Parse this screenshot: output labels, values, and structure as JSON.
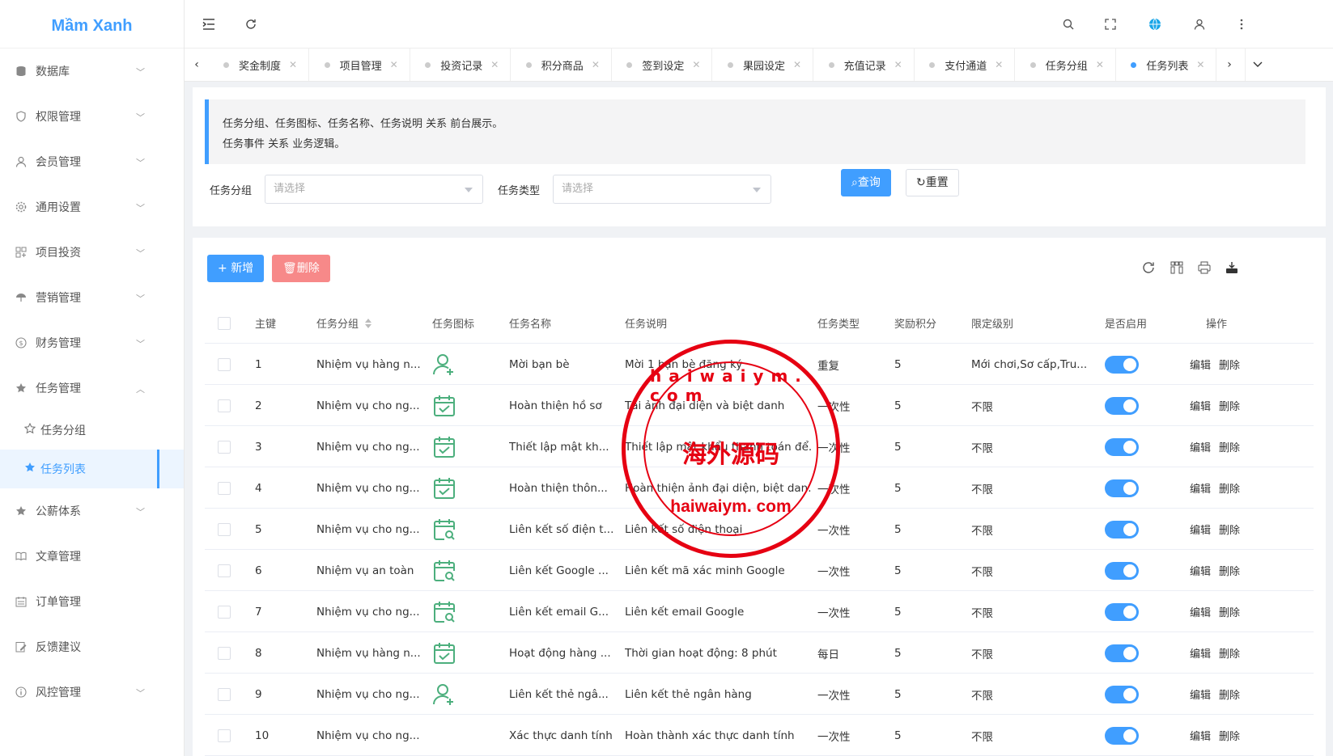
{
  "app": {
    "logo": "Mầm Xanh"
  },
  "sidebar": {
    "items": [
      {
        "label": "数据库",
        "icon": "database-icon"
      },
      {
        "label": "权限管理",
        "icon": "shield-icon"
      },
      {
        "label": "会员管理",
        "icon": "user-icon"
      },
      {
        "label": "通用设置",
        "icon": "gear-icon"
      },
      {
        "label": "项目投资",
        "icon": "grid-icon"
      },
      {
        "label": "营销管理",
        "icon": "umbrella-icon"
      },
      {
        "label": "财务管理",
        "icon": "dollar-icon"
      },
      {
        "label": "任务管理",
        "icon": "star-icon"
      }
    ],
    "sub_items": [
      {
        "label": "任务分组",
        "icon": "star-outline-icon"
      },
      {
        "label": "任务列表",
        "icon": "star-icon"
      }
    ],
    "items_after": [
      {
        "label": "公薪体系",
        "icon": "star-icon"
      },
      {
        "label": "文章管理",
        "icon": "book-icon"
      },
      {
        "label": "订单管理",
        "icon": "calendar-icon"
      },
      {
        "label": "反馈建议",
        "icon": "edit-icon"
      },
      {
        "label": "风控管理",
        "icon": "info-icon"
      }
    ]
  },
  "tabs": [
    "奖金制度",
    "项目管理",
    "投资记录",
    "积分商品",
    "签到设定",
    "果园设定",
    "充值记录",
    "支付通道",
    "任务分组",
    "任务列表"
  ],
  "notice": {
    "line1": "任务分组、任务图标、任务名称、任务说明 关系 前台展示。",
    "line2": "任务事件 关系 业务逻辑。"
  },
  "filters": {
    "group_label": "任务分组",
    "group_placeholder": "请选择",
    "type_label": "任务类型",
    "type_placeholder": "请选择",
    "search": "查询",
    "reset": "重置"
  },
  "toolbar": {
    "add": "新增",
    "delete": "删除"
  },
  "table": {
    "columns": [
      "主键",
      "任务分组",
      "任务图标",
      "任务名称",
      "任务说明",
      "任务类型",
      "奖励积分",
      "限定级别",
      "是否启用",
      "操作"
    ],
    "edit_label": "编辑",
    "delete_label": "删除",
    "rows": [
      {
        "id": "1",
        "group": "Nhiệm vụ hàng n...",
        "icon": "user-add-icon",
        "name": "Mời bạn bè",
        "desc": "Mời 1 bạn bè đăng ký",
        "type": "重复",
        "points": "5",
        "level": "Mới chơi,Sơ cấp,Tru...",
        "enabled": true
      },
      {
        "id": "2",
        "group": "Nhiệm vụ cho ng...",
        "icon": "calendar-check-icon",
        "name": "Hoàn thiện hồ sơ",
        "desc": "Tải ảnh đại diện và biệt danh",
        "type": "一次性",
        "points": "5",
        "level": "不限",
        "enabled": true
      },
      {
        "id": "3",
        "group": "Nhiệm vụ cho ng...",
        "icon": "calendar-check-icon",
        "name": "Thiết lập mật kh...",
        "desc": "Thiết lập mật khẩu thanh toán để...",
        "type": "一次性",
        "points": "5",
        "level": "不限",
        "enabled": true
      },
      {
        "id": "4",
        "group": "Nhiệm vụ cho ng...",
        "icon": "calendar-check-icon",
        "name": "Hoàn thiện thôn...",
        "desc": "Hoàn thiện ảnh đại diện, biệt dan...",
        "type": "一次性",
        "points": "5",
        "level": "不限",
        "enabled": true
      },
      {
        "id": "5",
        "group": "Nhiệm vụ cho ng...",
        "icon": "calendar-search-icon",
        "name": "Liên kết số điện t...",
        "desc": "Liên kết số điện thoại",
        "type": "一次性",
        "points": "5",
        "level": "不限",
        "enabled": true
      },
      {
        "id": "6",
        "group": "Nhiệm vụ an toàn",
        "icon": "calendar-search-icon",
        "name": "Liên kết Google ...",
        "desc": "Liên kết mã xác minh Google",
        "type": "一次性",
        "points": "5",
        "level": "不限",
        "enabled": true
      },
      {
        "id": "7",
        "group": "Nhiệm vụ cho ng...",
        "icon": "calendar-search-icon",
        "name": "Liên kết email G...",
        "desc": "Liên kết email Google",
        "type": "一次性",
        "points": "5",
        "level": "不限",
        "enabled": true
      },
      {
        "id": "8",
        "group": "Nhiệm vụ hàng n...",
        "icon": "calendar-check-icon",
        "name": "Hoạt động hàng ...",
        "desc": "Thời gian hoạt động: 8 phút",
        "type": "每日",
        "points": "5",
        "level": "不限",
        "enabled": true
      },
      {
        "id": "9",
        "group": "Nhiệm vụ cho ng...",
        "icon": "user-add-icon",
        "name": "Liên kết thẻ ngâ...",
        "desc": "Liên kết thẻ ngân hàng",
        "type": "一次性",
        "points": "5",
        "level": "不限",
        "enabled": true
      },
      {
        "id": "10",
        "group": "Nhiệm vụ cho ng...",
        "icon": "",
        "name": "Xác thực danh tính",
        "desc": "Hoàn thành xác thực danh tính",
        "type": "一次性",
        "points": "5",
        "level": "不限",
        "enabled": true
      }
    ]
  },
  "watermark": {
    "center": "海外源码",
    "bottom": "haiwaiym. com",
    "top": "haiwaiym. com"
  },
  "colors": {
    "accent": "#409eff",
    "danger": "#f78989",
    "stamp": "#e60012",
    "icon_green": "#4caf7d"
  }
}
